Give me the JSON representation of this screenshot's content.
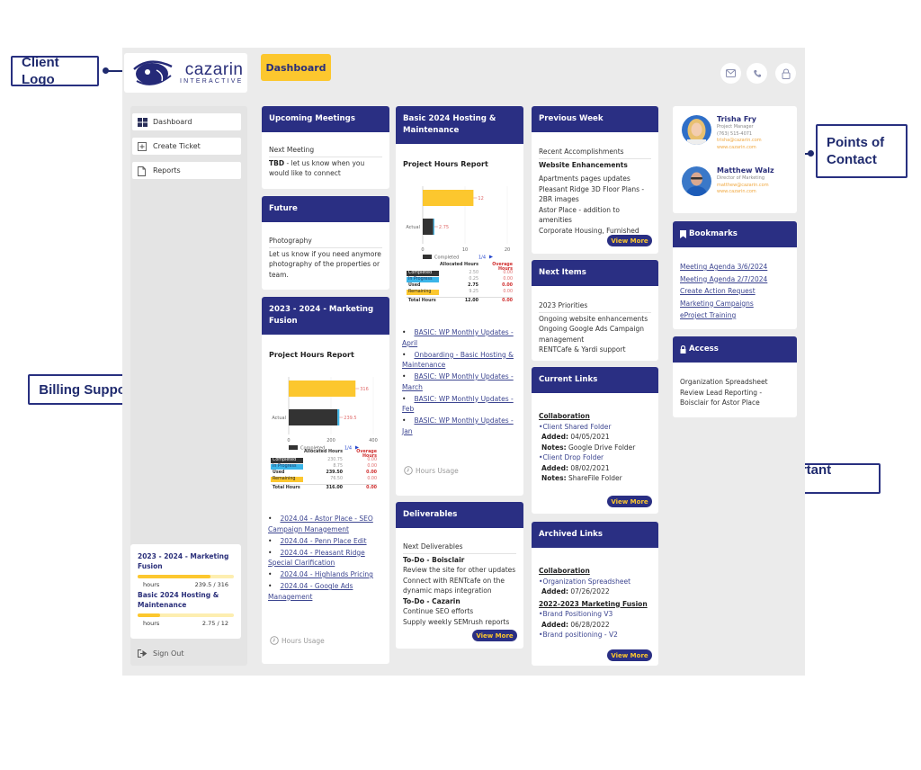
{
  "annotations": {
    "client_logo": "Client Logo",
    "points_of_contact": "Points of Contact",
    "billing_support": "Billing Support",
    "important_links": "Important Links"
  },
  "brand": {
    "name": "cazarin",
    "sub": "INTERACTIVE",
    "accent": "#fcc72e",
    "primary": "#2a2f83"
  },
  "header": {
    "dashboard_label": "Dashboard",
    "icons": [
      "mail-icon",
      "phone-icon",
      "lock-icon"
    ]
  },
  "sidebar": {
    "items": [
      {
        "label": "Dashboard",
        "icon": "grid-icon"
      },
      {
        "label": "Create Ticket",
        "icon": "plus-square-icon"
      },
      {
        "label": "Reports",
        "icon": "document-icon"
      }
    ],
    "usage": [
      {
        "title": "2023 - 2024 - Marketing Fusion",
        "unit": "hours",
        "used": 239.5,
        "total": 316,
        "value_text": "239.5 / 316"
      },
      {
        "title": "Basic 2024 Hosting & Maintenance",
        "unit": "hours",
        "used": 2.75,
        "total": 12,
        "value_text": "2.75 / 12"
      }
    ],
    "sign_out": "Sign Out"
  },
  "upcoming": {
    "title": "Upcoming Meetings",
    "sub": "Next Meeting",
    "bold": "TBD",
    "text": " - let us know when you would like to connect"
  },
  "future": {
    "title": "Future",
    "sub": "Photography",
    "text": "Let us know if you need anymore photography of the properties or team."
  },
  "marketing": {
    "title": "2023 - 2024 - Marketing Fusion",
    "report_title": "Project Hours Report",
    "links": [
      "2024.04 - Astor Place - SEO Campaign Management",
      "2024.04 - Penn Place Edit",
      "2024.04 - Pleasant Ridge Special Clarification",
      "2024.04 - Highlands Pricing",
      "2024.04 - Google Ads Management"
    ],
    "hours_usage": "Hours Usage"
  },
  "hosting": {
    "title": "Basic 2024 Hosting & Maintenance",
    "report_title": "Project Hours Report",
    "links": [
      "BASIC: WP Monthly Updates - April",
      "Onboarding - Basic Hosting & Maintenance",
      "BASIC: WP Monthly Updates - March",
      "BASIC: WP Monthly Updates - Feb",
      "BASIC: WP Monthly Updates - Jan"
    ],
    "hours_usage": "Hours Usage"
  },
  "chart_data": [
    {
      "type": "bar",
      "title": "Project Hours Report - 2023 - 2024 - Marketing Fusion",
      "orientation": "horizontal",
      "categories": [
        "Allocated",
        "Actual"
      ],
      "series": [
        {
          "name": "Allocated",
          "values": [
            316,
            null
          ],
          "color": "#fcc72e"
        },
        {
          "name": "Completed",
          "values": [
            null,
            230.75
          ],
          "color": "#333333"
        },
        {
          "name": "In Progress",
          "values": [
            null,
            8.75
          ],
          "color": "#3bb5e8"
        }
      ],
      "data_labels": [
        "316",
        "239.5"
      ],
      "xlim": [
        0,
        400
      ],
      "xticks": [
        "0",
        "200",
        "400"
      ],
      "legend": {
        "entry": "Completed",
        "pager": "1/4",
        "placement": "bottom"
      },
      "table": {
        "headers": [
          "",
          "Allocated Hours",
          "Overage Hours"
        ],
        "rows": [
          {
            "label": "Completed",
            "allocated": "230.75",
            "overage": "0.00",
            "tag": "#333333"
          },
          {
            "label": "In Progress",
            "allocated": "8.75",
            "overage": "0.00",
            "tag": "#3bb5e8"
          },
          {
            "label": "Used",
            "allocated": "239.50",
            "overage": "0.00",
            "tag": null,
            "bold": true
          },
          {
            "label": "Remaining",
            "allocated": "76.50",
            "overage": "0.00",
            "tag": "#fcc72e"
          },
          {
            "label": "Total Hours",
            "allocated": "316.00",
            "overage": "0.00",
            "tag": null,
            "bold": true
          }
        ]
      }
    },
    {
      "type": "bar",
      "title": "Project Hours Report - Basic 2024 Hosting & Maintenance",
      "orientation": "horizontal",
      "categories": [
        "Allocated",
        "Actual"
      ],
      "series": [
        {
          "name": "Allocated",
          "values": [
            12,
            null
          ],
          "color": "#fcc72e"
        },
        {
          "name": "Completed",
          "values": [
            null,
            2.5
          ],
          "color": "#333333"
        },
        {
          "name": "In Progress",
          "values": [
            null,
            0.25
          ],
          "color": "#3bb5e8"
        }
      ],
      "data_labels": [
        "12",
        "2.75"
      ],
      "xlim": [
        0,
        20
      ],
      "xticks": [
        "0",
        "10",
        "20"
      ],
      "legend": {
        "entry": "Completed",
        "pager": "1/4",
        "placement": "bottom"
      },
      "table": {
        "headers": [
          "",
          "Allocated Hours",
          "Overage Hours"
        ],
        "rows": [
          {
            "label": "Completed",
            "allocated": "2.50",
            "overage": "0.00",
            "tag": "#333333"
          },
          {
            "label": "In Progress",
            "allocated": "0.25",
            "overage": "0.00",
            "tag": "#3bb5e8"
          },
          {
            "label": "Used",
            "allocated": "2.75",
            "overage": "0.00",
            "tag": null,
            "bold": true
          },
          {
            "label": "Remaining",
            "allocated": "9.25",
            "overage": "0.00",
            "tag": "#fcc72e"
          },
          {
            "label": "Total Hours",
            "allocated": "12.00",
            "overage": "0.00",
            "tag": null,
            "bold": true
          }
        ]
      }
    }
  ],
  "deliverables": {
    "title": "Deliverables",
    "sub": "Next Deliverables",
    "groups": [
      {
        "heading": "To-Do - Boisclair",
        "lines": [
          "Review the site for other updates",
          "Connect with RENTcafe on the dynamic maps integration"
        ]
      },
      {
        "heading": "To-Do - Cazarin",
        "lines": [
          "Continue SEO efforts",
          "Supply weekly SEMrush reports"
        ]
      }
    ],
    "view_more": "View More"
  },
  "previous_week": {
    "title": "Previous Week",
    "sub": "Recent Accomplishments",
    "heading": "Website Enhancements",
    "lines": [
      "Apartments pages updates",
      "Pleasant Ridge 3D Floor Plans - 2BR images",
      "Astor Place - addition to amenities",
      "Corporate Housing, Furnished"
    ],
    "view_more": "View More"
  },
  "next_items": {
    "title": "Next Items",
    "sub": "2023 Priorities",
    "lines": [
      "Ongoing website enhancements",
      "Ongoing Google Ads Campaign management",
      "RENTCafe & Yardi support"
    ]
  },
  "current_links": {
    "title": "Current Links",
    "category": "Collaboration",
    "items": [
      {
        "name": "Client Shared Folder",
        "added_label": "Added:",
        "added": "04/05/2021",
        "notes_label": "Notes:",
        "notes": "Google Drive Folder"
      },
      {
        "name": "Client Drop Folder",
        "added_label": "Added:",
        "added": "08/02/2021",
        "notes_label": "Notes:",
        "notes": "ShareFile Folder"
      }
    ],
    "view_more": "View More"
  },
  "archived_links": {
    "title": "Archived Links",
    "groups": [
      {
        "category": "Collaboration",
        "items": [
          {
            "name": "Organization Spreadsheet",
            "added_label": "Added:",
            "added": "07/26/2022"
          }
        ]
      },
      {
        "category": "2022-2023 Marketing Fusion",
        "items": [
          {
            "name": "Brand Positioning V3",
            "added_label": "Added:",
            "added": "06/28/2022"
          },
          {
            "name": "Brand positioning - V2"
          }
        ]
      }
    ],
    "view_more": "View More"
  },
  "contacts": [
    {
      "name": "Trisha Fry",
      "role": "Project Manager",
      "phone": "(763) 515-4071",
      "email": "trisha@cazarin.com",
      "web": "www.cazarin.com"
    },
    {
      "name": "Matthew Walz",
      "role": "Director of Marketing",
      "email": "matthew@cazarin.com",
      "web": "www.cazarin.com"
    }
  ],
  "bookmarks": {
    "title": "Bookmarks",
    "links": [
      "Meeting Agenda 3/6/2024",
      "Meeting Agenda 2/7/2024",
      "Create Action Request",
      "Marketing Campaigns",
      "eProject Training"
    ]
  },
  "access": {
    "title": "Access",
    "lines": [
      "Organization Spreadsheet",
      "Review Lead Reporting - Boisclair for Astor Place"
    ]
  }
}
